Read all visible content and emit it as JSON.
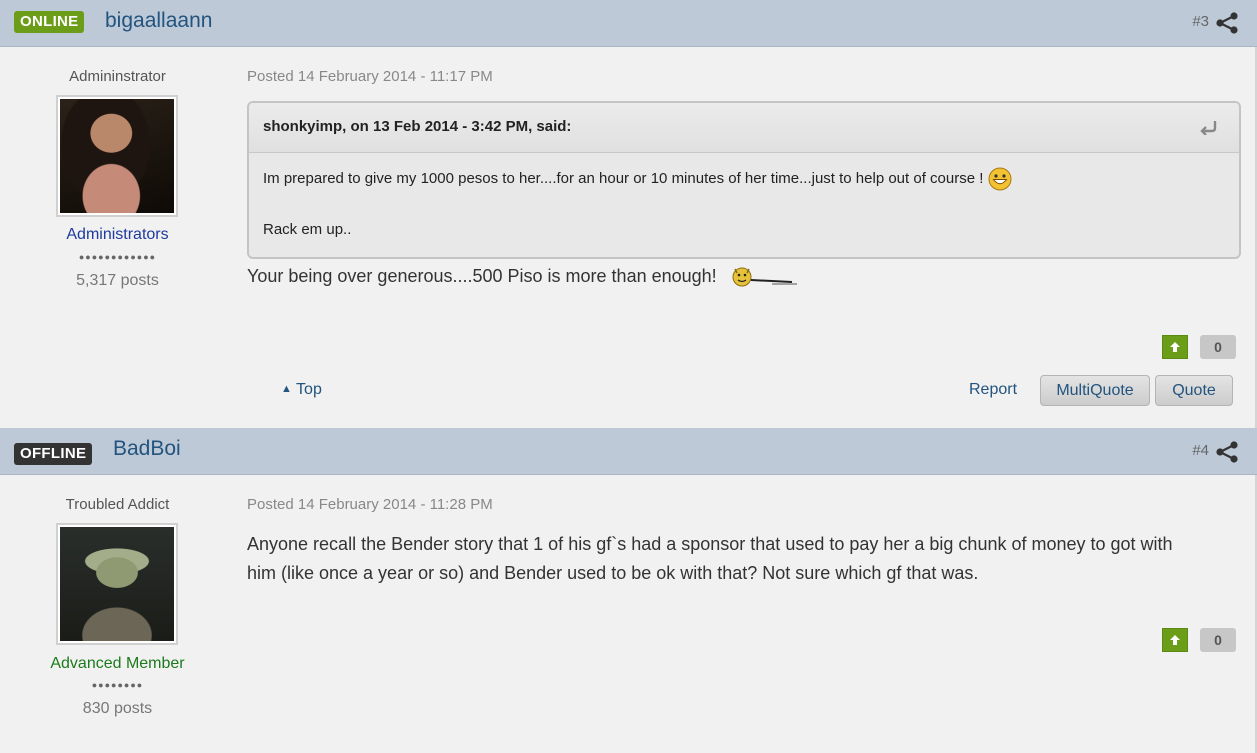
{
  "posts": [
    {
      "status": "ONLINE",
      "username": "bigaallaann",
      "post_number": "#3",
      "author_title": "Admininstrator",
      "member_group": "Administrators",
      "pips": "●●●●●●●●●●●●",
      "post_count": "5,317 posts",
      "posted": "Posted 14 February 2014 - 11:17 PM",
      "quote": {
        "header": "shonkyimp, on 13 Feb 2014 - 3:42 PM, said:",
        "line1": "Im prepared to give my 1000 pesos to her....for an hour or 10 minutes of her time...just to help out of course !",
        "line2": "Rack em up.."
      },
      "text": "Your being over generous....500 Piso is more than enough!",
      "reputation": "0",
      "top_label": "Top",
      "report_label": "Report",
      "multiquote_label": "MultiQuote",
      "quote_label": "Quote"
    },
    {
      "status": "OFFLINE",
      "username": "BadBoi",
      "post_number": "#4",
      "author_title": "Troubled Addict",
      "member_group": "Advanced Member",
      "pips": "●●●●●●●●",
      "post_count": "830 posts",
      "posted": "Posted 14 February 2014 - 11:28 PM",
      "text_line1": "Anyone recall the Bender story that 1 of his gf`s had a sponsor that used to pay her a big chunk of money to got with",
      "text_line2": "him  (like once a year or so) and Bender used to be ok with that? Not sure which gf that was.",
      "reputation": "0"
    }
  ],
  "colors": {
    "header_bg": "#bec9d8",
    "online": "#6c9d19",
    "offline": "#333333",
    "link": "#22547e",
    "admin_group": "#1f3a9e",
    "advanced_group": "#1c7a1c"
  },
  "icons": {
    "share": "share-icon",
    "rep_up": "arrow-up-icon",
    "quote_back": "return-arrow-icon",
    "smiley": "grin-smiley-icon",
    "devil_smiley": "devil-smiley-icon"
  }
}
